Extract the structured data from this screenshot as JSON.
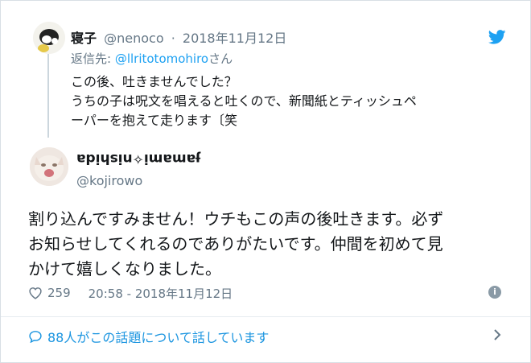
{
  "quoted_tweet": {
    "display_name": "寝子",
    "handle": "@nenoco",
    "separator": "·",
    "date": "2018年11月12日",
    "replying_prefix": "返信先: ",
    "replying_handle": "@llritotomohiro",
    "replying_suffix": "さん",
    "text": "この後、吐きませんでした？\nうちの子は呪文を唱えると吐くので、新聞紙とティッシュペ\nーパーを抱えて走ります〔笑"
  },
  "main_tweet": {
    "display_name": "ɟamami✧nishida",
    "handle": "@kojirowo",
    "text": "割り込んですみません！ウチもこの声の後吐きます。必ず\nお知らせしてくれるのでありがたいです。仲間を初めて見\nかけて嬉しくなりました。",
    "likes": "259",
    "timestamp": "20:58 - 2018年11月12日"
  },
  "conversation_link": "88人がこの話題について話しています",
  "icons": {
    "bird": "twitter-bird-icon",
    "heart": "heart-icon",
    "info": "info-icon",
    "bubble": "comment-bubble-icon",
    "chevron": "chevron-right-icon"
  },
  "colors": {
    "brand": "#1da1f2",
    "link": "#1b95e0",
    "muted": "#657786",
    "line": "#ccd6dd"
  }
}
